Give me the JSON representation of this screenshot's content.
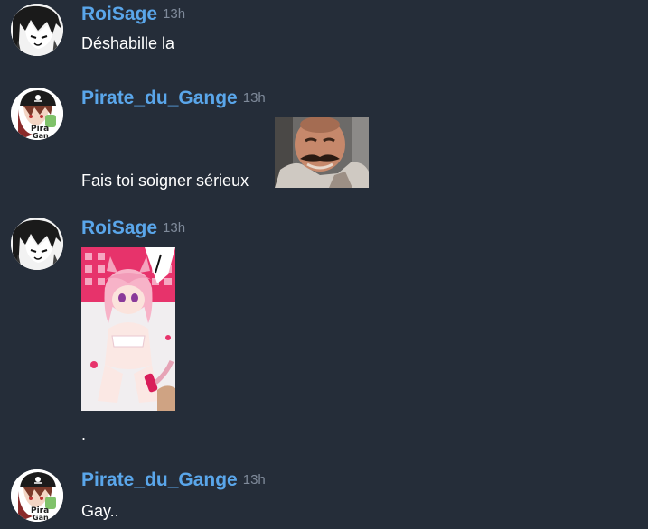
{
  "messages": [
    {
      "author": "RoiSage",
      "time": "13h",
      "text": "Déshabille la",
      "avatar_icon": "manga-face-avatar"
    },
    {
      "author": "Pirate_du_Gange",
      "time": "13h",
      "text": "Fais toi soigner sérieux",
      "avatar_icon": "pirate-anime-avatar",
      "sticker": "laughing-man-sticker"
    },
    {
      "author": "RoiSage",
      "time": "13h",
      "text": ".",
      "avatar_icon": "manga-face-avatar",
      "sticker": "anime-catgirl-sticker"
    },
    {
      "author": "Pirate_du_Gange",
      "time": "13h",
      "text": "Gay..",
      "avatar_icon": "pirate-anime-avatar"
    }
  ],
  "colors": {
    "background": "#252d39",
    "username": "#5aa6ea",
    "timestamp": "#7f8a9a",
    "text": "#ffffff"
  }
}
